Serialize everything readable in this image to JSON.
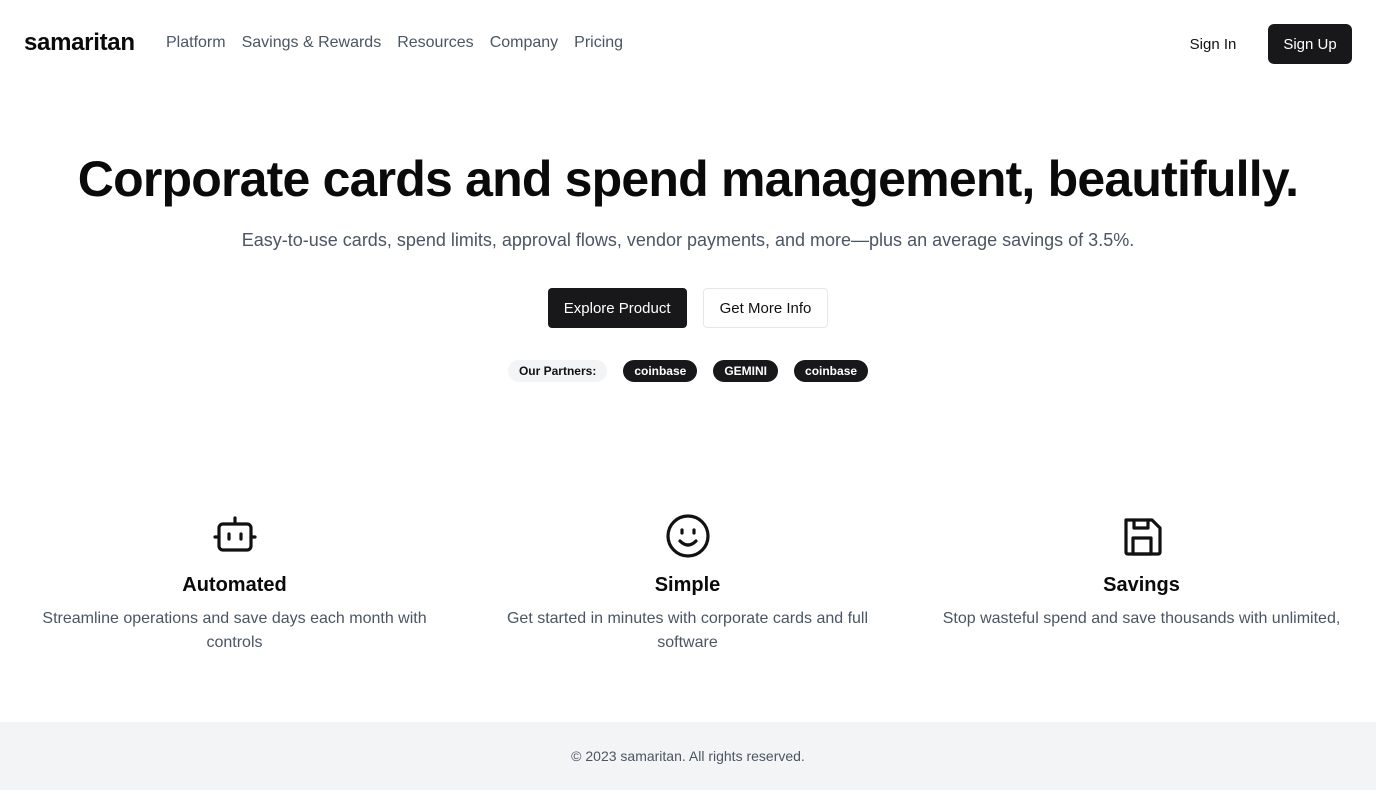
{
  "nav": {
    "logo": "samaritan",
    "links": [
      "Platform",
      "Savings & Rewards",
      "Resources",
      "Company",
      "Pricing"
    ],
    "sign_in": "Sign In",
    "sign_up": "Sign Up"
  },
  "hero": {
    "title": "Corporate cards and spend management, beautifully.",
    "subtitle": "Easy-to-use cards, spend limits, approval flows, vendor payments, and more—plus an average savings of 3.5%.",
    "primary_cta": "Explore Product",
    "secondary_cta": "Get More Info"
  },
  "partners": {
    "label": "Our Partners:",
    "items": [
      "coinbase",
      "GEMINI",
      "coinbase"
    ]
  },
  "features": [
    {
      "icon": "robot-icon",
      "title": "Automated",
      "description": "Streamline operations and save days each month with controls"
    },
    {
      "icon": "smiley-face-icon",
      "title": "Simple",
      "description": "Get started in minutes with corporate cards and full software"
    },
    {
      "icon": "floppy-disk-icon",
      "title": "Savings",
      "description": "Stop wasteful spend and save thousands with unlimited,"
    }
  ],
  "footer": {
    "text": "© 2023 samaritan. All rights reserved."
  },
  "colors": {
    "primary": "#18181b",
    "muted_text": "#4b5563",
    "footer_bg": "#f3f4f6"
  }
}
